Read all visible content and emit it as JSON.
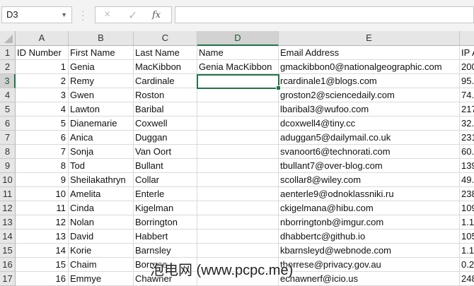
{
  "name_box": {
    "value": "D3"
  },
  "formula_bar": {
    "cancel_icon": "×",
    "enter_icon": "✓",
    "fx_label": "fx",
    "value": ""
  },
  "columns": [
    "A",
    "B",
    "C",
    "D",
    "E",
    ""
  ],
  "rows": [
    {
      "n": "1",
      "cells": [
        "ID Number",
        "First Name",
        "Last Name",
        "Name",
        "Email Address",
        "IP A"
      ]
    },
    {
      "n": "2",
      "cells": [
        "1",
        "Genia",
        "MacKibbon",
        "Genia MacKibbon",
        "gmackibbon0@nationalgeographic.com",
        "200"
      ]
    },
    {
      "n": "3",
      "cells": [
        "2",
        "Remy",
        "Cardinale",
        "",
        "rcardinale1@blogs.com",
        "95."
      ]
    },
    {
      "n": "4",
      "cells": [
        "3",
        "Gwen",
        "Roston",
        "",
        "groston2@sciencedaily.com",
        "74."
      ]
    },
    {
      "n": "5",
      "cells": [
        "4",
        "Lawton",
        "Baribal",
        "",
        "lbaribal3@wufoo.com",
        "217"
      ]
    },
    {
      "n": "6",
      "cells": [
        "5",
        "Dianemarie",
        "Coxwell",
        "",
        "dcoxwell4@tiny.cc",
        "32."
      ]
    },
    {
      "n": "7",
      "cells": [
        "6",
        "Anica",
        "Duggan",
        "",
        "aduggan5@dailymail.co.uk",
        "231"
      ]
    },
    {
      "n": "8",
      "cells": [
        "7",
        "Sonja",
        "Van Oort",
        "",
        "svanoort6@technorati.com",
        "60."
      ]
    },
    {
      "n": "9",
      "cells": [
        "8",
        "Tod",
        "Bullant",
        "",
        "tbullant7@over-blog.com",
        "139"
      ]
    },
    {
      "n": "10",
      "cells": [
        "9",
        "Sheilakathryn",
        "Collar",
        "",
        "scollar8@wiley.com",
        "49."
      ]
    },
    {
      "n": "11",
      "cells": [
        "10",
        "Amelita",
        "Enterle",
        "",
        "aenterle9@odnoklassniki.ru",
        "238"
      ]
    },
    {
      "n": "12",
      "cells": [
        "11",
        "Cinda",
        "Kigelman",
        "",
        "ckigelmana@hibu.com",
        "109"
      ]
    },
    {
      "n": "13",
      "cells": [
        "12",
        "Nolan",
        "Borrington",
        "",
        "nborringtonb@imgur.com",
        "1.1"
      ]
    },
    {
      "n": "14",
      "cells": [
        "13",
        "David",
        "Habbert",
        "",
        "dhabbertc@github.io",
        "105"
      ]
    },
    {
      "n": "15",
      "cells": [
        "14",
        "Korie",
        "Barnsley",
        "",
        "kbarnsleyd@webnode.com",
        "1.1"
      ]
    },
    {
      "n": "16",
      "cells": [
        "15",
        "Chaim",
        "Borrese",
        "",
        "tborrese@privacy.gov.au",
        "0.2"
      ]
    },
    {
      "n": "17",
      "cells": [
        "16",
        "Emmye",
        "Chawner",
        "",
        "echawnerf@icio.us",
        "248"
      ]
    }
  ],
  "watermark": "泡电网 (www.pcpc.me)"
}
